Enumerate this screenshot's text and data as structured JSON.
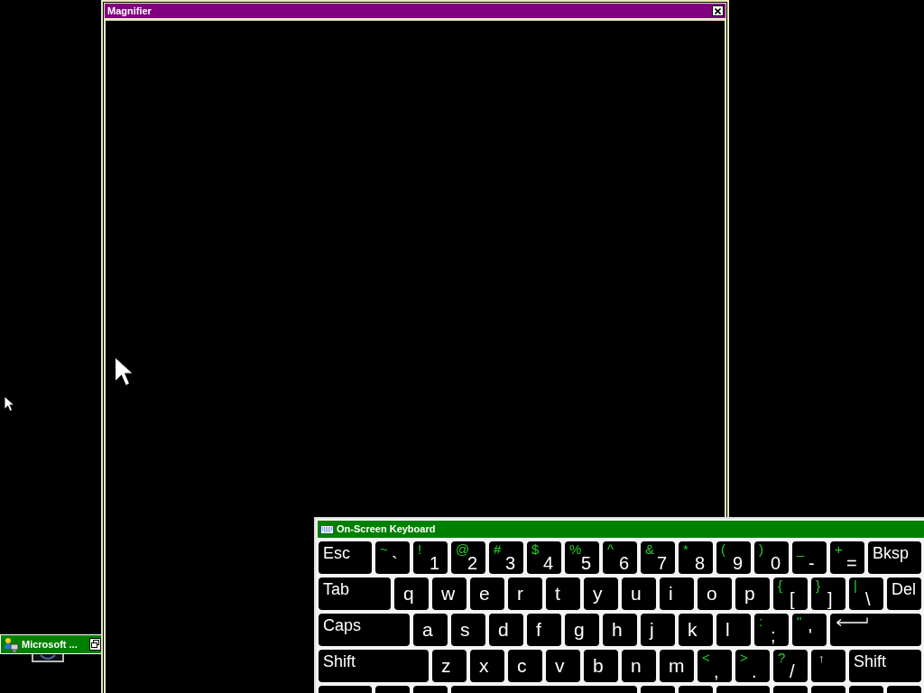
{
  "magnifier_window": {
    "title": "Magnifier"
  },
  "taskbar_button": {
    "label": "Microsoft ..."
  },
  "keyboard_window": {
    "title": "On-Screen Keyboard",
    "rows": [
      [
        {
          "kind": "label",
          "label": "Esc"
        },
        {
          "kind": "dual",
          "shift": "~",
          "main": "`"
        },
        {
          "kind": "dual",
          "shift": "!",
          "main": "1"
        },
        {
          "kind": "dual",
          "shift": "@",
          "main": "2"
        },
        {
          "kind": "dual",
          "shift": "#",
          "main": "3"
        },
        {
          "kind": "dual",
          "shift": "$",
          "main": "4"
        },
        {
          "kind": "dual",
          "shift": "%",
          "main": "5"
        },
        {
          "kind": "dual",
          "shift": "^",
          "main": "6"
        },
        {
          "kind": "dual",
          "shift": "&",
          "main": "7"
        },
        {
          "kind": "dual",
          "shift": "*",
          "main": "8"
        },
        {
          "kind": "dual",
          "shift": "(",
          "main": "9"
        },
        {
          "kind": "dual",
          "shift": ")",
          "main": "0"
        },
        {
          "kind": "dual",
          "shift": "_",
          "main": "-"
        },
        {
          "kind": "dual",
          "shift": "+",
          "main": "="
        },
        {
          "kind": "label",
          "label": "Bksp"
        }
      ],
      [
        {
          "kind": "label",
          "label": "Tab"
        },
        {
          "kind": "char",
          "label": "q"
        },
        {
          "kind": "char",
          "label": "w"
        },
        {
          "kind": "char",
          "label": "e"
        },
        {
          "kind": "char",
          "label": "r"
        },
        {
          "kind": "char",
          "label": "t"
        },
        {
          "kind": "char",
          "label": "y"
        },
        {
          "kind": "char",
          "label": "u"
        },
        {
          "kind": "char",
          "label": "i"
        },
        {
          "kind": "char",
          "label": "o"
        },
        {
          "kind": "char",
          "label": "p"
        },
        {
          "kind": "dual",
          "shift": "{",
          "main": "["
        },
        {
          "kind": "dual",
          "shift": "}",
          "main": "]"
        },
        {
          "kind": "dual",
          "shift": "|",
          "main": "\\"
        },
        {
          "kind": "label",
          "label": "Del"
        }
      ],
      [
        {
          "kind": "label",
          "label": "Caps"
        },
        {
          "kind": "char",
          "label": "a"
        },
        {
          "kind": "char",
          "label": "s"
        },
        {
          "kind": "char",
          "label": "d"
        },
        {
          "kind": "char",
          "label": "f"
        },
        {
          "kind": "char",
          "label": "g"
        },
        {
          "kind": "char",
          "label": "h"
        },
        {
          "kind": "char",
          "label": "j"
        },
        {
          "kind": "char",
          "label": "k"
        },
        {
          "kind": "char",
          "label": "l"
        },
        {
          "kind": "dual",
          "shift": ":",
          "main": ";"
        },
        {
          "kind": "dual",
          "shift": "\"",
          "main": "'"
        },
        {
          "kind": "enter"
        }
      ],
      [
        {
          "kind": "label",
          "label": "Shift"
        },
        {
          "kind": "char",
          "label": "z"
        },
        {
          "kind": "char",
          "label": "x"
        },
        {
          "kind": "char",
          "label": "c"
        },
        {
          "kind": "char",
          "label": "v"
        },
        {
          "kind": "char",
          "label": "b"
        },
        {
          "kind": "char",
          "label": "n"
        },
        {
          "kind": "char",
          "label": "m"
        },
        {
          "kind": "dual",
          "shift": "<",
          "main": ","
        },
        {
          "kind": "dual",
          "shift": ">",
          "main": "."
        },
        {
          "kind": "dual",
          "shift": "?",
          "main": "/"
        },
        {
          "kind": "arrow",
          "label": "↑"
        },
        {
          "kind": "label",
          "label": "Shift"
        }
      ]
    ]
  }
}
